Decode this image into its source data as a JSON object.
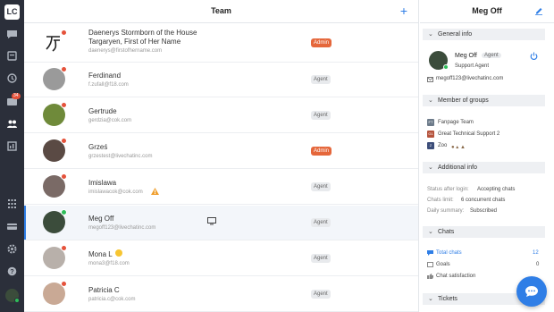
{
  "nav": {
    "logo": "LC",
    "items": [
      "chats-icon",
      "tickets-icon",
      "archives-icon",
      "visitors-icon",
      "team-icon",
      "reports-icon",
      "apps-icon",
      "billing-icon",
      "settings-icon",
      "help-icon"
    ],
    "badge": "34"
  },
  "team": {
    "title": "Team",
    "add_label": "+",
    "agents": [
      {
        "name": "Daenerys Stormborn of the House",
        "name2": "Targaryen, First of Her Name",
        "email": "daenerys@firstofhername.com",
        "role": "Admin",
        "status": "red"
      },
      {
        "name": "Ferdinand",
        "email": "f.zufall@f18.com",
        "role": "Agent",
        "status": "red"
      },
      {
        "name": "Gertrude",
        "email": "gerdzia@cok.com",
        "role": "Agent",
        "status": "red"
      },
      {
        "name": "Grześ",
        "email": "grzestest@livechatinc.com",
        "role": "Admin",
        "status": "red"
      },
      {
        "name": "Imislawa",
        "email": "imislawacok@cok.com",
        "role": "Agent",
        "status": "red"
      },
      {
        "name": "Meg Off",
        "email": "megoff123@livechatinc.com",
        "role": "Agent",
        "status": "green"
      },
      {
        "name": "Mona L",
        "email": "mona3@f18.com",
        "role": "Agent",
        "status": "red"
      },
      {
        "name": "Patricia C",
        "email": "patricia.c@cok.com",
        "role": "Agent",
        "status": "red"
      }
    ]
  },
  "panel": {
    "title": "Meg Off",
    "general_info": "General info",
    "agent_name": "Meg Off",
    "agent_badge": "Agent",
    "agent_role": "Support Agent",
    "agent_email": "megoff123@livechatinc.com",
    "groups_title": "Member of groups",
    "groups": [
      {
        "tag": "FT",
        "name": "Fanpage Team",
        "color": "#6d7b8a"
      },
      {
        "tag": "G1",
        "name": "Great Technical Support 2",
        "color": "#b5533c"
      },
      {
        "tag": "Z",
        "name": "Zoo",
        "color": "#3d4e7a"
      }
    ],
    "additional_title": "Additional info",
    "status_label": "Status after login:",
    "status_value": "Accepting chats",
    "limit_label": "Chats limit:",
    "limit_value": "6 concurrent chats",
    "summary_label": "Daily summary:",
    "summary_value": "Subscribed",
    "chats_title": "Chats",
    "total_label": "Total chats",
    "total_value": "12",
    "goals_label": "Goals",
    "goals_value": "0",
    "satisfaction_label": "Chat satisfaction",
    "tickets_title": "Tickets"
  },
  "colors": {
    "accent": "#2f7ee6",
    "admin": "#e5673b",
    "nav": "#2b2f3a"
  }
}
